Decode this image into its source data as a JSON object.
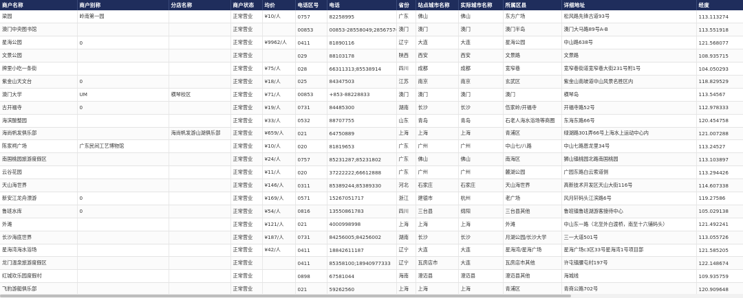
{
  "columns": [
    "商户名称",
    "商户别称",
    "分店名称",
    "商户状态",
    "均价",
    "电话区号",
    "电话",
    "省份",
    "站点城市名称",
    "实际城市名称",
    "所属区县",
    "详细地址",
    "经度"
  ],
  "rows": [
    [
      "梁园",
      "岭南第一园",
      "",
      "正常营业",
      "¥10/人",
      "0757",
      "82258995",
      "广东",
      "佛山",
      "佛山",
      "东方广场",
      "松风路先锋古道93号",
      "113.113274"
    ],
    [
      "澳门中央图书馆",
      "",
      "",
      "正常营业",
      "",
      "00853",
      "00853-28558049;28567576",
      "澳门",
      "澳门",
      "澳门",
      "澳门半岛",
      "澳门大马路89号A-B",
      "113.551918"
    ],
    [
      "星海公园",
      "0",
      "",
      "正常营业",
      "¥9962/人",
      "0411",
      "81890116",
      "辽宁",
      "大连",
      "大连",
      "星海公园",
      "中山路638号",
      "121.568077"
    ],
    [
      "文景公园",
      "",
      "",
      "正常营业",
      "",
      "029",
      "88103178",
      "陕西",
      "西安",
      "西安",
      "文景路",
      "文景路",
      "108.935715"
    ],
    [
      "牌里小吃一条街",
      "",
      "",
      "正常营业",
      "¥75/人",
      "028",
      "66311313;85538914",
      "四川",
      "成都",
      "成都",
      "宽窄巷",
      "宽窄巷街道宽窄巷大街231号附1号",
      "104.050293"
    ],
    [
      "紫金山天文台",
      "0",
      "",
      "正常营业",
      "¥18/人",
      "025",
      "84347503",
      "江苏",
      "南京",
      "南京",
      "玄武区",
      "紫金山南坡道中山风景名胜区内",
      "118.829529"
    ],
    [
      "澳门大学",
      "UM",
      "横琴校区",
      "正常营业",
      "¥71/人",
      "00853",
      "+853-88228833",
      "澳门",
      "澳门",
      "澳门",
      "澳门",
      "横琴岛",
      "113.54567"
    ],
    [
      "古开福寺",
      "0",
      "",
      "正常营业",
      "¥19/人",
      "0731",
      "84485300",
      "湖南",
      "长沙",
      "长沙",
      "伍家岭/开福寺",
      "开福寺路52号",
      "112.978333"
    ],
    [
      "海滨酸整园",
      "",
      "",
      "正常营业",
      "¥33/人",
      "0532",
      "88707755",
      "山东",
      "青岛",
      "青岛",
      "石老人海水浴场等商圈",
      "东海东路66号",
      "120.454758"
    ],
    [
      "海尚帆发俱乐部",
      "",
      "海尚帆发游山湖俱乐部",
      "正常营业",
      "¥659/人",
      "021",
      "64750889",
      "上海",
      "上海",
      "上海",
      "青浦区",
      "绿湖路301弄66号上海水上运动中心内",
      "121.007288"
    ],
    [
      "陈家祠广场",
      "广东民间工艺博物馆",
      "",
      "正常营业",
      "¥10/人",
      "020",
      "81819653",
      "广东",
      "广州",
      "广州",
      "中山七/八路",
      "中山七路恩龙里34号",
      "113.24527"
    ],
    [
      "南国桃园旅游度假区",
      "",
      "",
      "正常营业",
      "¥24/人",
      "0757",
      "85231287;85231802",
      "广东",
      "佛山",
      "佛山",
      "南海区",
      "狮山镇桃园北路南国桃园",
      "113.103897"
    ],
    [
      "云谷花园",
      "",
      "",
      "正常营业",
      "¥11/人",
      "020",
      "37222222;66612888",
      "广东",
      "广州",
      "广州",
      "麓湖公园",
      "广园东路白云索道侧",
      "113.294426"
    ],
    [
      "天山海世界",
      "",
      "",
      "正常营业",
      "¥146/人",
      "0311",
      "85389244;85389330",
      "河北",
      "石家庄",
      "石家庄",
      "天山海世界",
      "高新技术开发区天山大街116号",
      "114.607338"
    ],
    [
      "新安江龙舟漂游",
      "0",
      "",
      "正常营业",
      "¥169/人",
      "0571",
      "15267051717",
      "浙江",
      "建德市",
      "杭州",
      "老广场",
      "风月轩码头江滨路6号",
      "119.27586"
    ],
    [
      "鲁班水库",
      "0",
      "",
      "正常营业",
      "¥54/人",
      "0816",
      "13550861783",
      "四川",
      "三台县",
      "绵阳",
      "三台县其他",
      "鲁班镇鲁班湖游客接待中心",
      "105.029138"
    ],
    [
      "外滩",
      "",
      "",
      "正常营业",
      "¥121/人",
      "021",
      "4000998998",
      "上海",
      "上海",
      "上海",
      "外滩",
      "中山东一路（北至外白渡桥，南至十六铺码头）",
      "121.492241"
    ],
    [
      "长沙海底世界",
      "",
      "",
      "正常营业",
      "¥187/人",
      "0731",
      "84256005;84256002",
      "湖南",
      "长沙",
      "长沙",
      "月湖公园/长沙大学",
      "三一大道501号",
      "113.055726"
    ],
    [
      "星海湾海水浴场",
      "",
      "",
      "正常营业",
      "¥42/人",
      "0411",
      "18842611187",
      "辽宁",
      "大连",
      "大连",
      "星海湾/星海广场",
      "星海广场c3区33号星海湾1号项目部",
      "121.585205"
    ],
    [
      "龙门温泉旅游度假区",
      "",
      "",
      "正常营业",
      "",
      "0411",
      "85358100;18940977333",
      "辽宁",
      "瓦房店市",
      "大连",
      "瓦房店市其他",
      "许屯镇腰屯村197号",
      "122.148674"
    ],
    [
      "红城欢乐园度假村",
      "",
      "",
      "正常营业",
      "",
      "0898",
      "67581044",
      "海南",
      "澄迈县",
      "澄迈县",
      "澄迈县其他",
      "海城线",
      "109.935759"
    ],
    [
      "飞豹游艇俱乐部",
      "",
      "",
      "正常营业",
      "",
      "021",
      "59262560",
      "上海",
      "上海",
      "上海",
      "青浦区",
      "青商公路702号",
      "120.909648"
    ]
  ]
}
